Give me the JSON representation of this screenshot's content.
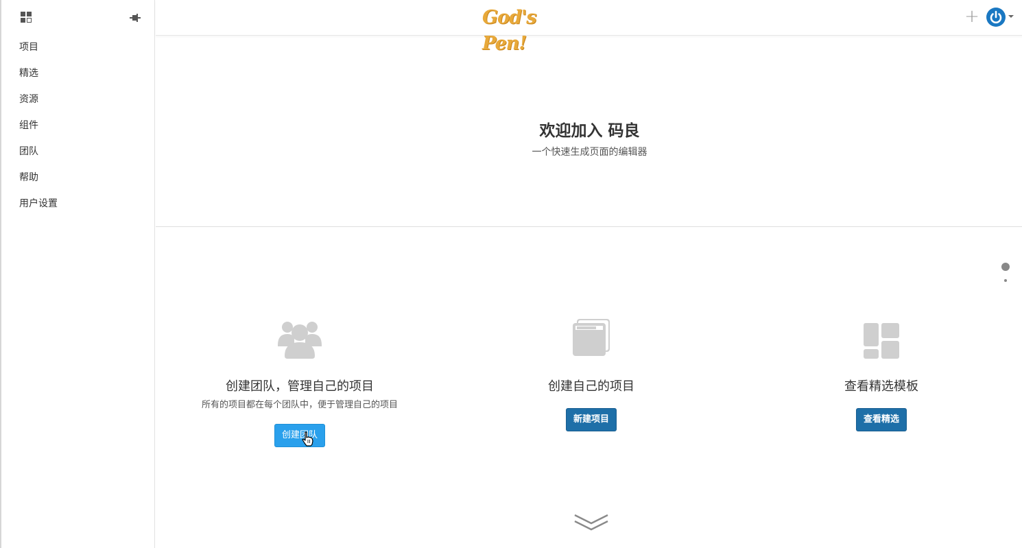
{
  "sidebar": {
    "items": [
      {
        "label": "项目"
      },
      {
        "label": "精选"
      },
      {
        "label": "资源"
      },
      {
        "label": "组件"
      },
      {
        "label": "团队"
      },
      {
        "label": "帮助"
      },
      {
        "label": "用户设置"
      }
    ]
  },
  "header": {
    "logo_text": "God's Pen!",
    "plus_label": "+"
  },
  "hero": {
    "title": "欢迎加入 码良",
    "subtitle": "一个快速生成页面的编辑器"
  },
  "cards": [
    {
      "title": "创建团队，管理自己的项目",
      "subtitle": "所有的项目都在每个团队中，便于管理自己的项目",
      "button": "创建团队"
    },
    {
      "title": "创建自己的项目",
      "button": "新建项目"
    },
    {
      "title": "查看精选模板",
      "button": "查看精选"
    }
  ],
  "colors": {
    "accent": "#1e6fa8",
    "accent_hover": "#2aa0ec",
    "logo": "#e8a93a",
    "power": "#1a78c2"
  }
}
